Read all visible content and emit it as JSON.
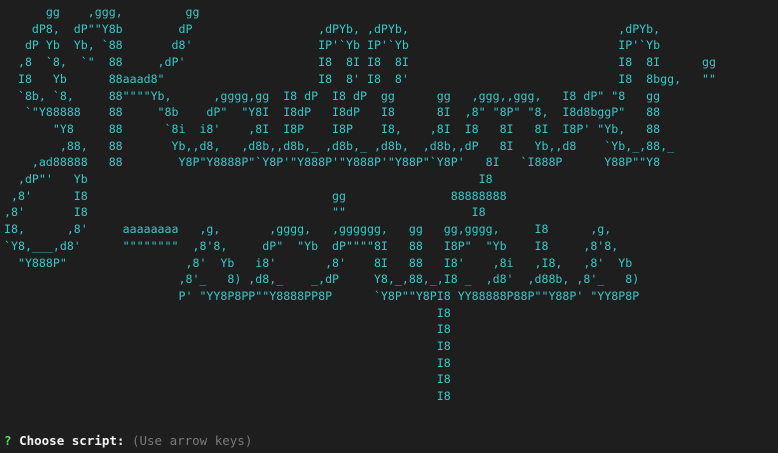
{
  "terminal": {
    "background_color": "#1e1e1e",
    "art_color": "#37c8c8",
    "ascii_art": "      gg    ,ggg,         gg\n    dP8,  dP\"\"Y8b        dP                  ,dPYb, ,dPYb,                              ,dPYb,\n   dP Yb  Yb, `88       d8'                  IP'`Yb IP'`Yb                              IP'`Yb\n  ,8  `8,  `\"  88     ,dP'                   I8  8I I8  8I                              I8  8I      gg\n  I8   Yb      88aaad8\"                      I8  8' I8  8'                              I8  8bgg,   \"\"\n  `8b, `8,     88\"\"\"\"Yb,      ,gggg,gg  I8 dP  I8 dP  gg      gg   ,ggg,,ggg,   I8 dP\" \"8   gg\n   `\"Y88888    88     \"8b    dP\"  \"Y8I  I8dP   I8dP   I8      8I  ,8\" \"8P\" \"8,  I8d8bggP\"   88\n       \"Y8     88      `8i  i8'    ,8I  I8P    I8P    I8,    ,8I  I8   8I   8I  I8P' \"Yb,   88\n        ,88,   88       Yb,,d8,   ,d8b,,d8b,_ ,d8b,_ ,d8b,  ,d8b,,dP   8I   Yb,,d8    `Yb,_,88,_\n    ,ad88888   88        Y8P\"Y8888P\"`Y8P'\"Y888P'\"Y888P'\"Y88P\"`Y8P'   8I   `I888P      Y88P\"\"Y8\n  ,dP\"'   Yb                                                        I8\n ,8'      I8                                   gg               88888888\n,8'       I8                                   \"\"                  I8\nI8,      ,8'     aaaaaaaa   ,g,       ,gggg,   ,gggggg,   gg   gg,gggg,     I8      ,g,\n`Y8,___,d8'      \"\"\"\"\"\"\"\"  ,8'8,     dP\"  \"Yb  dP\"\"\"\"8I   88   I8P\"  \"Yb    I8     ,8'8,\n  \"Y888P\"                 ,8'  Yb   i8'       ,8'    8I   88   I8'    ,8i   ,I8,   ,8'  Yb\n                         ,8'_   8) ,d8,_    _,dP     Y8,_,88,_,I8 _  ,d8'  ,d88b, ,8'_   8)\n                         P' \"YY8P8PP\"\"Y8888PP8P      `Y8P\"\"Y8PI8 YY88888P88P\"\"Y88P' \"YY8P8P\n                                                              I8\n                                                              I8\n                                                              I8\n                                                              I8\n                                                              I8\n                                                              I8"
  },
  "prompt": {
    "marker": "?",
    "question": "Choose script:",
    "hint": "(Use arrow keys)",
    "marker_color": "#5fd75f",
    "question_color": "#f2f2f2",
    "hint_color": "#7a7a7a"
  }
}
